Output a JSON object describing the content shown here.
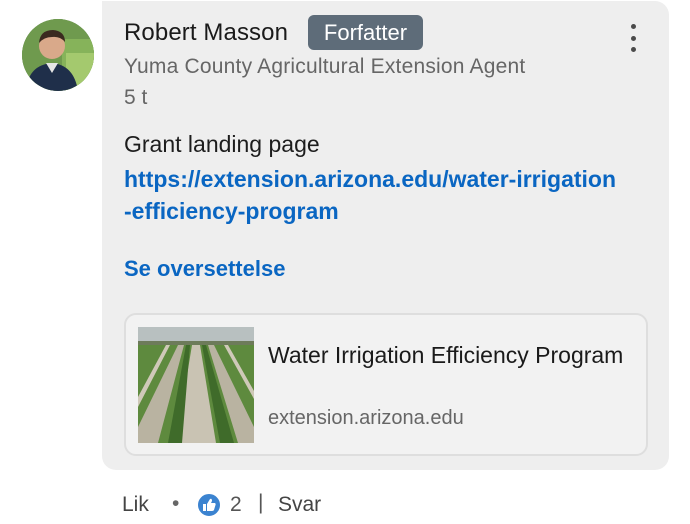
{
  "comment": {
    "author": {
      "name": "Robert Masson",
      "badge": "Forfatter",
      "headline": "Yuma County Agricultural Extension Agent",
      "avatar_icon": "profile-photo"
    },
    "timestamp": "5 t",
    "text": "Grant landing page",
    "link": {
      "line1": "https://extension.arizona.edu/water-irrigation",
      "line2": "-efficiency-program"
    },
    "translate_label": "Se oversettelse",
    "more_icon": "more-vertical-icon",
    "preview": {
      "title": "Water Irrigation Efficiency Program",
      "domain": "extension.arizona.edu",
      "thumbnail_icon": "irrigated-field-photo"
    }
  },
  "actions": {
    "like_label": "Lik",
    "separator_dot": "•",
    "reaction_icon": "like-reaction-icon",
    "reaction_count": "2",
    "divider": "|",
    "reply_label": "Svar"
  },
  "colors": {
    "link": "#0a66c2",
    "badge_bg": "#5e6c79",
    "bubble_bg": "#eeeeee",
    "reaction": "#3b83d0"
  }
}
